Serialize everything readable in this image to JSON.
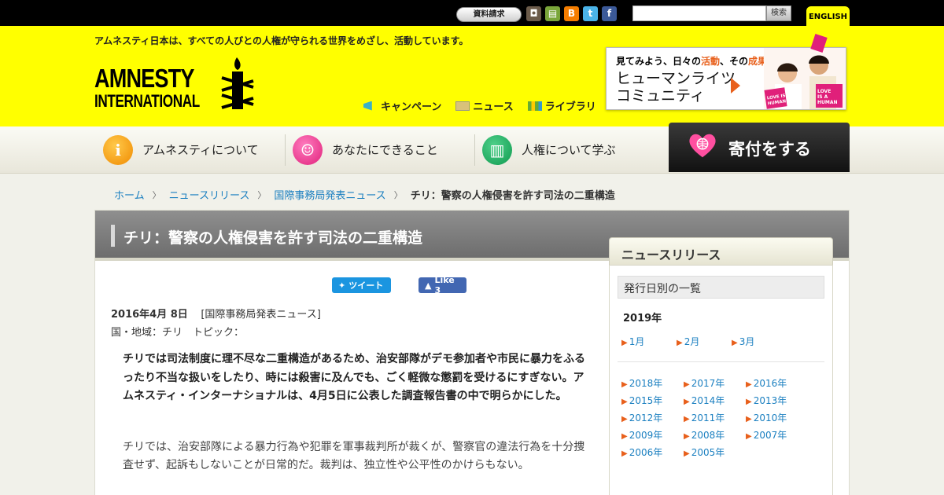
{
  "topbar": {
    "request_label": "資料請求",
    "search_placeholder": "",
    "search_button": "検索",
    "english_label": "ENGLISH",
    "social_icons": [
      "instagram-icon",
      "shop-cart-icon",
      "blogger-icon",
      "twitter-icon",
      "facebook-icon"
    ]
  },
  "header": {
    "tagline": "アムネスティ日本は、すべての人びとの人権が守られる世界をめざし、活動しています。",
    "logo_line1": "AMNESTY",
    "logo_line2": "INTERNATIONAL",
    "links": [
      "キャンペーン",
      "ニュース",
      "ライブラリ"
    ],
    "banner": {
      "line1_a": "見てみよう、日々の",
      "line1_b": "活動",
      "line1_c": "、その",
      "line1_d": "成果",
      "line1_e": "。",
      "line2": "ヒューマンライツ",
      "line3": "コミュニティ",
      "sign1": "LOVE IS A HUMAN",
      "sign2": "LOVE IS A HUMAN"
    }
  },
  "nav": {
    "items": [
      "アムネスティについて",
      "あなたにできること",
      "人権について学ぶ"
    ],
    "donate": "寄付をする"
  },
  "breadcrumb": {
    "items": [
      "ホーム",
      "ニュースリリース",
      "国際事務局発表ニュース"
    ],
    "current": "チリ：警察の人権侵害を許す司法の二重構造"
  },
  "article": {
    "title": "チリ：警察の人権侵害を許す司法の二重構造",
    "tweet_label": "ツイート",
    "like_label": "Like 3",
    "date": "2016年4月 8日",
    "category": "[国際事務局発表ニュース]",
    "region": "国・地域：チリ　トピック：",
    "lead": "チリでは司法制度に理不尽な二重構造があるため、治安部隊がデモ参加者や市民に暴力をふるったり不当な扱いをしたり、時には殺害に及んでも、ごく軽微な懲罰を受けるにすぎない。アムネスティ・インターナショナルは、4月5日に公表した調査報告書の中で明らかにした。",
    "body": "チリでは、治安部隊による暴力行為や犯罪を軍事裁判所が裁くが、警察官の違法行為を十分捜査せず、起訴もしないことが日常的だ。裁判は、独立性や公平性のかけらもない。"
  },
  "sidebar": {
    "tab": "ニュースリリース",
    "heading": "発行日別の一覧",
    "current_year": "2019年",
    "months": [
      "1月",
      "2月",
      "3月"
    ],
    "years": [
      "2018年",
      "2017年",
      "2016年",
      "2015年",
      "2014年",
      "2013年",
      "2012年",
      "2011年",
      "2010年",
      "2009年",
      "2008年",
      "2007年",
      "2006年",
      "2005年"
    ]
  },
  "colors": {
    "brand_yellow": "#ffff00",
    "link_blue": "#1a7fc0",
    "accent_orange": "#e8601c"
  }
}
